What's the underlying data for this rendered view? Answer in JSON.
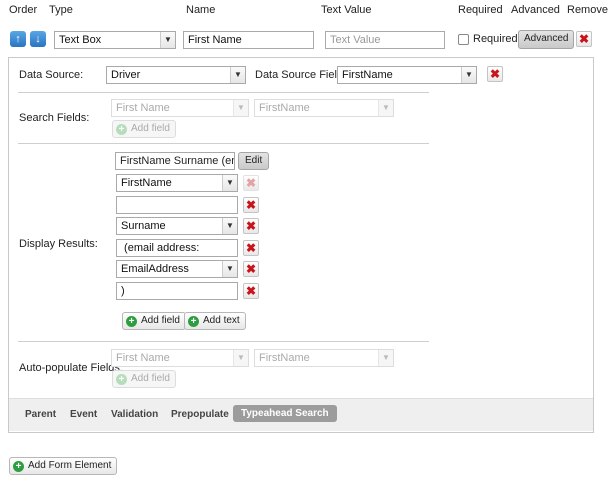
{
  "header": {
    "order": "Order",
    "type": "Type",
    "name": "Name",
    "text_value": "Text Value",
    "required": "Required",
    "advanced": "Advanced",
    "remove": "Remove"
  },
  "row": {
    "up_icon": "up-arrow-icon",
    "down_icon": "down-arrow-icon",
    "type_value": "Text Box",
    "name_value": "First Name",
    "text_value_placeholder": "Text Value",
    "required_checked": false,
    "required_label": "Required",
    "advanced_button": "Advanced",
    "delete_icon": "close-icon"
  },
  "panel": {
    "data_source_label": "Data Source:",
    "data_source_value": "Driver",
    "data_source_field_label": "Data Source Field:",
    "data_source_field_value": "FirstName",
    "search_fields": {
      "label": "Search Fields:",
      "select1_value": "First Name",
      "select2_value": "FirstName",
      "add_field": "Add field"
    },
    "display_results": {
      "label": "Display Results:",
      "preview_value": "FirstName Surname (email",
      "edit_button": "Edit",
      "items": [
        {
          "kind": "select",
          "value": "FirstName",
          "delete_disabled": true
        },
        {
          "kind": "text",
          "value": "",
          "delete_disabled": false
        },
        {
          "kind": "select",
          "value": "Surname",
          "delete_disabled": false
        },
        {
          "kind": "text",
          "value": " (email address:",
          "delete_disabled": false
        },
        {
          "kind": "select",
          "value": "EmailAddress",
          "delete_disabled": false
        },
        {
          "kind": "text",
          "value": ")",
          "delete_disabled": false
        }
      ],
      "add_field": "Add field",
      "add_text": "Add text"
    },
    "auto_populate": {
      "label": "Auto-populate Fields:",
      "select1_value": "First Name",
      "select2_value": "FirstName",
      "add_field": "Add field"
    },
    "tabs": [
      "Parent",
      "Event",
      "Validation",
      "Prepopulate",
      "Typeahead Search"
    ],
    "active_tab": "Typeahead Search"
  },
  "footer": {
    "add_form_element": "Add Form Element"
  },
  "colors": {
    "delete_red": "#c8141b",
    "add_green": "#2d9e3f",
    "arrow_blue": "#2a74c0",
    "active_tab_bg": "#9c9c9c"
  }
}
